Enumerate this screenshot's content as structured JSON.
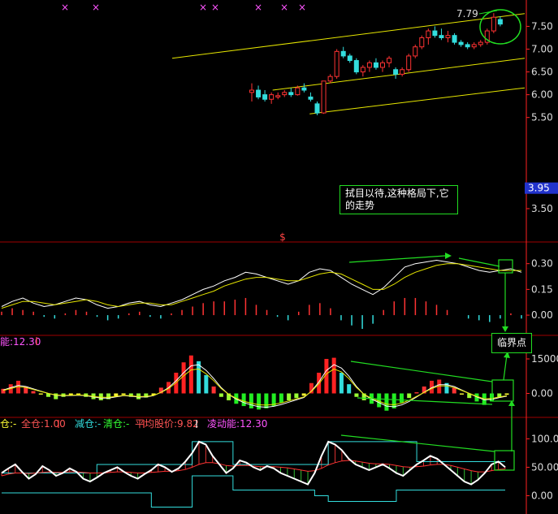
{
  "annotations": {
    "note": "拭目以待,这种格局下,它的走势",
    "critical": "临界点"
  },
  "markers": {
    "s_mark": "$",
    "x_mark": "×"
  },
  "colors": {
    "up": "#ff3333",
    "down": "#33dddd",
    "channel": "#e6e600",
    "grid": "#a00000",
    "axis": "#ff2222",
    "green": "#22dd22"
  },
  "chart_data": [
    {
      "type": "candlestick",
      "panel": "price",
      "ylim": [
        3.0,
        7.9
      ],
      "yticks": [
        "7.50",
        "7.00",
        "6.50",
        "6.00",
        "5.50",
        "3.50"
      ],
      "price_badge": "3.95",
      "high_label": "7.79",
      "candles": [
        {
          "o": 6.05,
          "h": 6.25,
          "l": 5.85,
          "c": 6.1
        },
        {
          "o": 6.1,
          "h": 6.2,
          "l": 5.9,
          "c": 5.95
        },
        {
          "o": 6.0,
          "h": 6.1,
          "l": 5.85,
          "c": 5.9
        },
        {
          "o": 5.9,
          "h": 6.05,
          "l": 5.8,
          "c": 6.0
        },
        {
          "o": 5.95,
          "h": 6.05,
          "l": 5.9,
          "c": 5.98
        },
        {
          "o": 6.0,
          "h": 6.1,
          "l": 5.95,
          "c": 6.05
        },
        {
          "o": 6.05,
          "h": 6.15,
          "l": 5.95,
          "c": 6.0
        },
        {
          "o": 6.0,
          "h": 6.2,
          "l": 5.98,
          "c": 6.15
        },
        {
          "o": 6.15,
          "h": 6.25,
          "l": 6.05,
          "c": 6.1
        },
        {
          "o": 5.95,
          "h": 6.05,
          "l": 5.85,
          "c": 5.9
        },
        {
          "o": 5.8,
          "h": 5.85,
          "l": 5.55,
          "c": 5.6
        },
        {
          "o": 5.6,
          "h": 6.3,
          "l": 5.58,
          "c": 6.3
        },
        {
          "o": 6.3,
          "h": 6.45,
          "l": 6.25,
          "c": 6.4
        },
        {
          "o": 6.4,
          "h": 7.0,
          "l": 6.35,
          "c": 6.95
        },
        {
          "o": 6.95,
          "h": 7.05,
          "l": 6.8,
          "c": 6.85
        },
        {
          "o": 6.85,
          "h": 6.9,
          "l": 6.7,
          "c": 6.75
        },
        {
          "o": 6.75,
          "h": 6.8,
          "l": 6.45,
          "c": 6.5
        },
        {
          "o": 6.5,
          "h": 6.65,
          "l": 6.4,
          "c": 6.6
        },
        {
          "o": 6.6,
          "h": 6.75,
          "l": 6.5,
          "c": 6.7
        },
        {
          "o": 6.7,
          "h": 6.8,
          "l": 6.55,
          "c": 6.6
        },
        {
          "o": 6.6,
          "h": 6.75,
          "l": 6.5,
          "c": 6.7
        },
        {
          "o": 6.7,
          "h": 6.85,
          "l": 6.6,
          "c": 6.8
        },
        {
          "o": 6.55,
          "h": 6.6,
          "l": 6.35,
          "c": 6.45
        },
        {
          "o": 6.45,
          "h": 6.6,
          "l": 6.4,
          "c": 6.55
        },
        {
          "o": 6.55,
          "h": 6.9,
          "l": 6.5,
          "c": 6.85
        },
        {
          "o": 6.85,
          "h": 7.1,
          "l": 6.8,
          "c": 7.05
        },
        {
          "o": 7.05,
          "h": 7.3,
          "l": 7.0,
          "c": 7.25
        },
        {
          "o": 7.25,
          "h": 7.45,
          "l": 7.1,
          "c": 7.4
        },
        {
          "o": 7.4,
          "h": 7.5,
          "l": 7.25,
          "c": 7.3
        },
        {
          "o": 7.3,
          "h": 7.45,
          "l": 7.2,
          "c": 7.25
        },
        {
          "o": 7.25,
          "h": 7.4,
          "l": 7.15,
          "c": 7.3
        },
        {
          "o": 7.3,
          "h": 7.35,
          "l": 7.1,
          "c": 7.15
        },
        {
          "o": 7.15,
          "h": 7.2,
          "l": 7.05,
          "c": 7.1
        },
        {
          "o": 7.1,
          "h": 7.15,
          "l": 7.0,
          "c": 7.05
        },
        {
          "o": 7.05,
          "h": 7.15,
          "l": 7.0,
          "c": 7.1
        },
        {
          "o": 7.1,
          "h": 7.2,
          "l": 7.05,
          "c": 7.15
        },
        {
          "o": 7.15,
          "h": 7.45,
          "l": 7.1,
          "c": 7.4
        },
        {
          "o": 7.4,
          "h": 7.79,
          "l": 7.35,
          "c": 7.7
        },
        {
          "o": 7.65,
          "h": 7.72,
          "l": 7.5,
          "c": 7.55
        }
      ],
      "channel": [
        {
          "x1": 0,
          "y1": 6.8,
          "x2": 1,
          "y2": 7.78
        },
        {
          "x1": 0.285,
          "y1": 6.1,
          "x2": 1,
          "y2": 6.8
        },
        {
          "x1": 0.39,
          "y1": 5.58,
          "x2": 1,
          "y2": 6.15
        }
      ]
    },
    {
      "type": "line",
      "panel": "macd",
      "ylim": [
        -0.08,
        0.36
      ],
      "yticks": [
        "0.30",
        "0.15",
        "0.00"
      ],
      "series": [
        {
          "values": [
            0.05,
            0.08,
            0.1,
            0.07,
            0.05,
            0.06,
            0.08,
            0.1,
            0.09,
            0.06,
            0.04,
            0.05,
            0.07,
            0.08,
            0.06,
            0.05,
            0.07,
            0.09,
            0.12,
            0.15,
            0.17,
            0.2,
            0.22,
            0.25,
            0.24,
            0.22,
            0.2,
            0.18,
            0.2,
            0.25,
            0.27,
            0.26,
            0.22,
            0.18,
            0.15,
            0.12,
            0.16,
            0.22,
            0.28,
            0.3,
            0.31,
            0.32,
            0.31,
            0.3,
            0.28,
            0.26,
            0.25,
            0.26,
            0.27,
            0.25
          ]
        },
        {
          "values": [
            0.04,
            0.06,
            0.08,
            0.08,
            0.07,
            0.06,
            0.07,
            0.08,
            0.09,
            0.08,
            0.06,
            0.05,
            0.06,
            0.07,
            0.07,
            0.06,
            0.06,
            0.08,
            0.1,
            0.12,
            0.14,
            0.17,
            0.19,
            0.21,
            0.22,
            0.22,
            0.21,
            0.2,
            0.2,
            0.22,
            0.24,
            0.25,
            0.24,
            0.21,
            0.18,
            0.15,
            0.15,
            0.18,
            0.22,
            0.25,
            0.27,
            0.29,
            0.3,
            0.3,
            0.29,
            0.28,
            0.27,
            0.26,
            0.26,
            0.26
          ]
        }
      ],
      "bars": [
        0.02,
        0.04,
        0.03,
        0.02,
        -0.01,
        -0.02,
        0.01,
        0.03,
        0.02,
        -0.01,
        -0.03,
        -0.02,
        0.01,
        0.02,
        -0.01,
        -0.02,
        0.01,
        0.03,
        0.05,
        0.07,
        0.08,
        0.08,
        0.09,
        0.1,
        0.06,
        0.03,
        -0.01,
        -0.03,
        0.02,
        0.06,
        0.07,
        0.04,
        -0.03,
        -0.06,
        -0.08,
        -0.05,
        0.03,
        0.08,
        0.1,
        0.1,
        0.08,
        0.06,
        0.03,
        0.0,
        -0.02,
        -0.03,
        -0.04,
        -0.02,
        0.01,
        -0.02
      ]
    },
    {
      "type": "bar",
      "panel": "energy",
      "ylim": [
        -9000,
        21000
      ],
      "yticks": [
        "15000",
        "0.00"
      ],
      "title_value": "能:12.30",
      "values": [
        2000,
        4000,
        5500,
        3000,
        1000,
        -500,
        -1500,
        -2500,
        -1500,
        -800,
        -600,
        -1500,
        -2500,
        -3000,
        -2500,
        -1200,
        -600,
        -1500,
        -2500,
        -1800,
        -800,
        2500,
        5000,
        9000,
        13500,
        16500,
        14000,
        8000,
        3000,
        -1500,
        -3000,
        -4500,
        -5500,
        -6500,
        -7000,
        -6500,
        -5500,
        -4000,
        -3000,
        -2000,
        -1000,
        4500,
        9000,
        15000,
        15500,
        9000,
        4000,
        -1500,
        -3000,
        -4500,
        -6000,
        -7500,
        -6500,
        -4000,
        -2000,
        500,
        3000,
        5500,
        6000,
        4500,
        2500,
        -500,
        -2000,
        -3500,
        -5000,
        -3500,
        -1500,
        -600
      ],
      "line": [
        1500,
        2500,
        3500,
        3000,
        2000,
        1000,
        0,
        -800,
        -1000,
        -900,
        -800,
        -1000,
        -1500,
        -2000,
        -2000,
        -1500,
        -1000,
        -1200,
        -1600,
        -1500,
        -1000,
        500,
        2500,
        5500,
        9000,
        12000,
        12500,
        10000,
        6500,
        2500,
        -500,
        -2500,
        -4000,
        -5000,
        -5800,
        -6000,
        -5600,
        -4800,
        -3800,
        -2800,
        -1800,
        1000,
        5000,
        10000,
        12500,
        11000,
        7500,
        3000,
        -500,
        -2500,
        -4000,
        -5500,
        -5800,
        -5000,
        -3500,
        -1500,
        500,
        2500,
        3800,
        3800,
        3000,
        1500,
        0,
        -1500,
        -2800,
        -2600,
        -1800,
        -1200
      ]
    },
    {
      "type": "line",
      "panel": "position",
      "ylim": [
        -25,
        112
      ],
      "yticks": [
        "100.0",
        "50.00",
        "0.00"
      ],
      "labels": [
        "仓:-",
        "全仓:1.00",
        "减仓:-",
        "清仓:-",
        "平均股价:9.82",
        "凌动能:12.30"
      ],
      "white": [
        40,
        48,
        55,
        42,
        30,
        38,
        52,
        45,
        35,
        40,
        48,
        42,
        30,
        25,
        32,
        40,
        45,
        50,
        42,
        35,
        30,
        38,
        45,
        55,
        50,
        42,
        48,
        60,
        75,
        95,
        90,
        70,
        55,
        40,
        48,
        62,
        58,
        50,
        45,
        52,
        48,
        40,
        35,
        30,
        25,
        20,
        40,
        70,
        95,
        90,
        80,
        65,
        55,
        50,
        45,
        50,
        55,
        48,
        40,
        35,
        45,
        55,
        62,
        70,
        65,
        55,
        45,
        35,
        25,
        20,
        28,
        40,
        55,
        60,
        50
      ],
      "red": [
        35,
        38,
        40,
        40,
        39,
        40,
        41,
        42,
        41,
        41,
        42,
        42,
        41,
        40,
        40,
        40,
        41,
        42,
        42,
        41,
        40,
        40,
        41,
        42,
        43,
        43,
        44,
        46,
        50,
        55,
        58,
        58,
        56,
        53,
        52,
        53,
        53,
        52,
        51,
        51,
        51,
        50,
        49,
        47,
        45,
        43,
        44,
        48,
        54,
        58,
        61,
        62,
        61,
        59,
        57,
        56,
        56,
        55,
        53,
        51,
        50,
        51,
        52,
        54,
        55,
        55,
        53,
        50,
        47,
        44,
        42,
        42,
        44,
        46,
        47
      ],
      "cyan_upper": [
        40,
        40,
        40,
        40,
        40,
        40,
        40,
        40,
        40,
        40,
        40,
        40,
        40,
        40,
        55,
        55,
        55,
        55,
        55,
        55,
        55,
        55,
        55,
        55,
        55,
        55,
        55,
        55,
        95,
        95,
        95,
        95,
        95,
        95,
        55,
        55,
        55,
        55,
        55,
        55,
        55,
        55,
        55,
        55,
        55,
        55,
        55,
        55,
        95,
        95,
        95,
        95,
        95,
        95,
        95,
        95,
        95,
        95,
        95,
        95,
        95,
        60,
        60,
        60,
        60,
        60,
        60,
        60,
        60,
        60,
        60,
        60,
        60,
        60,
        60
      ],
      "cyan_lower": [
        5,
        5,
        5,
        5,
        5,
        5,
        5,
        5,
        5,
        5,
        5,
        5,
        5,
        5,
        5,
        5,
        5,
        5,
        5,
        5,
        5,
        5,
        -20,
        -20,
        -20,
        -20,
        -20,
        -20,
        35,
        35,
        35,
        35,
        35,
        35,
        10,
        10,
        10,
        10,
        10,
        10,
        10,
        10,
        10,
        10,
        10,
        10,
        0,
        0,
        -10,
        -10,
        -10,
        -10,
        -10,
        -10,
        -10,
        -10,
        -10,
        -10,
        10,
        10,
        10,
        10,
        10,
        10,
        10,
        10,
        10,
        10,
        10,
        10,
        10,
        10,
        10,
        10,
        10
      ]
    }
  ]
}
